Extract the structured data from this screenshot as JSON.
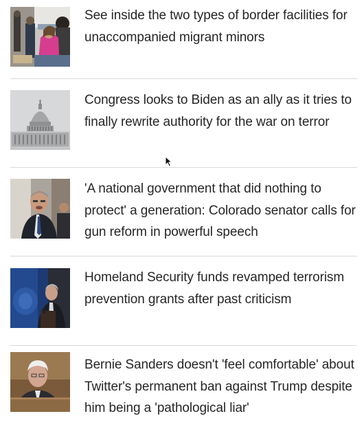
{
  "stories": [
    {
      "headline": "See inside the two types of border facilities for unaccompanied migrant minors",
      "thumbnail_icon": "border-facility-photo"
    },
    {
      "headline": "Congress looks to Biden as an ally as it tries to finally rewrite authority for the war on terror",
      "thumbnail_icon": "capitol-dome-photo"
    },
    {
      "headline": "'A national government that did nothing to protect' a generation: Colorado senator calls for gun reform in powerful speech",
      "thumbnail_icon": "senator-speaking-photo"
    },
    {
      "headline": "Homeland Security funds revamped terrorism prevention grants after past criticism",
      "thumbnail_icon": "press-briefing-photo"
    },
    {
      "headline": "Bernie Sanders doesn't 'feel comfortable' about Twitter's permanent ban against Trump despite him being a 'pathological liar'",
      "thumbnail_icon": "bernie-sanders-photo"
    }
  ],
  "colors": {
    "text": "#262626",
    "divider": "#d9d9d9",
    "background": "#ffffff"
  }
}
